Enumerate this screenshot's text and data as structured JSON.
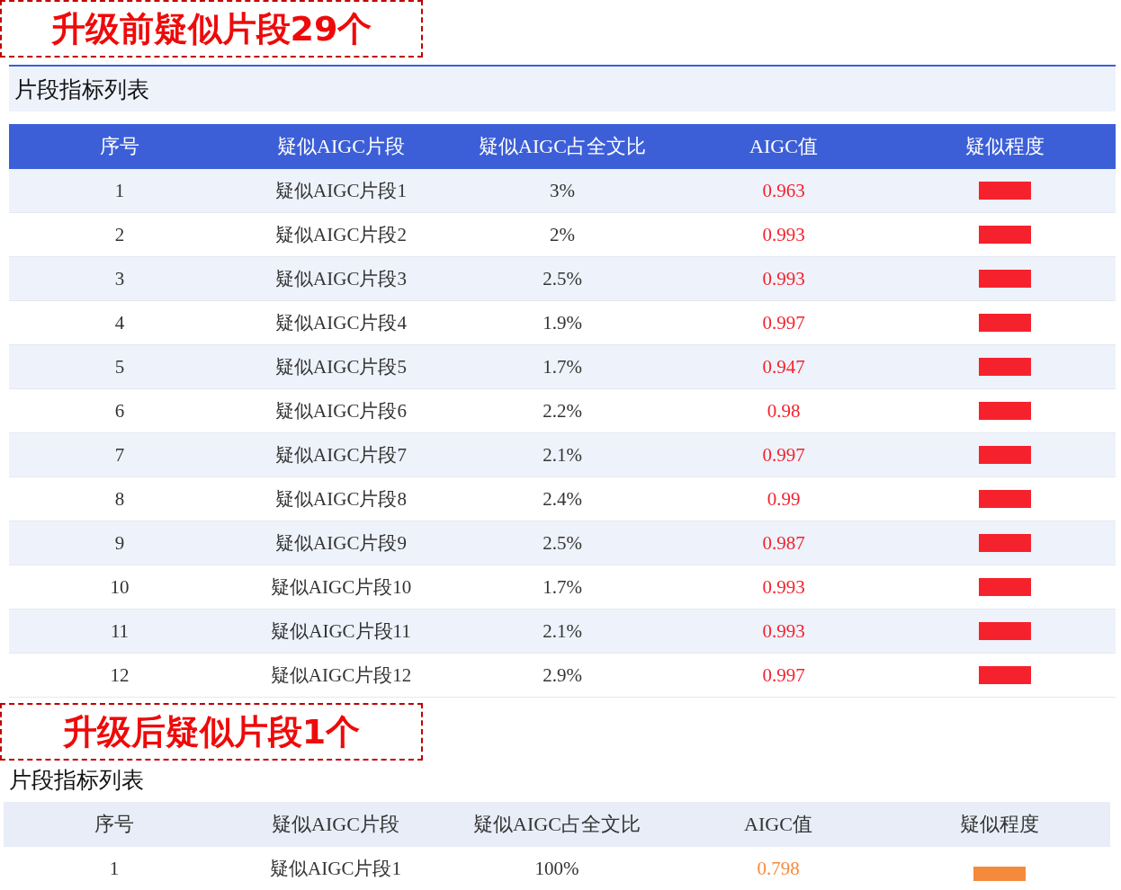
{
  "sections": [
    {
      "banner": "升级前疑似片段29个",
      "kind": "framed",
      "list_title": "片段指标列表",
      "columns": [
        "序号",
        "疑似AIGC片段",
        "疑似AIGC占全文比",
        "AIGC值",
        "疑似程度"
      ],
      "rows": [
        {
          "index": "1",
          "fragment": "疑似AIGC片段1",
          "share": "3%",
          "value": "0.963",
          "color": "#f5222d"
        },
        {
          "index": "2",
          "fragment": "疑似AIGC片段2",
          "share": "2%",
          "value": "0.993",
          "color": "#f5222d"
        },
        {
          "index": "3",
          "fragment": "疑似AIGC片段3",
          "share": "2.5%",
          "value": "0.993",
          "color": "#f5222d"
        },
        {
          "index": "4",
          "fragment": "疑似AIGC片段4",
          "share": "1.9%",
          "value": "0.997",
          "color": "#f5222d"
        },
        {
          "index": "5",
          "fragment": "疑似AIGC片段5",
          "share": "1.7%",
          "value": "0.947",
          "color": "#f5222d"
        },
        {
          "index": "6",
          "fragment": "疑似AIGC片段6",
          "share": "2.2%",
          "value": "0.98",
          "color": "#f5222d"
        },
        {
          "index": "7",
          "fragment": "疑似AIGC片段7",
          "share": "2.1%",
          "value": "0.997",
          "color": "#f5222d"
        },
        {
          "index": "8",
          "fragment": "疑似AIGC片段8",
          "share": "2.4%",
          "value": "0.99",
          "color": "#f5222d"
        },
        {
          "index": "9",
          "fragment": "疑似AIGC片段9",
          "share": "2.5%",
          "value": "0.987",
          "color": "#f5222d"
        },
        {
          "index": "10",
          "fragment": "疑似AIGC片段10",
          "share": "1.7%",
          "value": "0.993",
          "color": "#f5222d"
        },
        {
          "index": "11",
          "fragment": "疑似AIGC片段11",
          "share": "2.1%",
          "value": "0.993",
          "color": "#f5222d"
        },
        {
          "index": "12",
          "fragment": "疑似AIGC片段12",
          "share": "2.9%",
          "value": "0.997",
          "color": "#f5222d"
        }
      ]
    },
    {
      "banner": "升级后疑似片段1个",
      "kind": "plain",
      "list_title": "片段指标列表",
      "columns": [
        "序号",
        "疑似AIGC片段",
        "疑似AIGC占全文比",
        "AIGC值",
        "疑似程度"
      ],
      "rows": [
        {
          "index": "1",
          "fragment": "疑似AIGC片段1",
          "share": "100%",
          "value": "0.798",
          "color": "#f58a3c"
        }
      ]
    }
  ]
}
